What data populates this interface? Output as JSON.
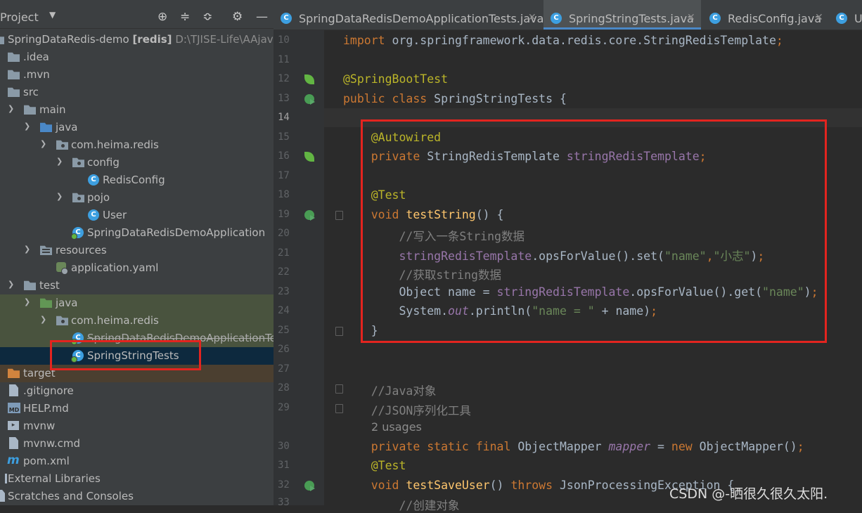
{
  "sidebar": {
    "title": "Project",
    "tree": [
      {
        "label": "SpringDataRedis-demo",
        "bold": "[redis]",
        "path": "D:\\TJISE-Life\\AAjava-",
        "icon": "module-icon"
      },
      {
        "label": ".idea",
        "icon": "folder-icon"
      },
      {
        "label": ".mvn",
        "icon": "folder-icon"
      },
      {
        "label": "src",
        "icon": "folder-icon"
      },
      {
        "label": "main",
        "icon": "folder-icon"
      },
      {
        "label": "java",
        "icon": "source-folder-icon"
      },
      {
        "label": "com.heima.redis",
        "icon": "package-icon"
      },
      {
        "label": "config",
        "icon": "package-icon"
      },
      {
        "label": "RedisConfig",
        "icon": "class-icon"
      },
      {
        "label": "pojo",
        "icon": "package-icon"
      },
      {
        "label": "User",
        "icon": "class-icon"
      },
      {
        "label": "SpringDataRedisDemoApplication",
        "icon": "spring-boot-class-icon"
      },
      {
        "label": "resources",
        "icon": "resources-folder-icon"
      },
      {
        "label": "application.yaml",
        "icon": "yaml-file-icon"
      },
      {
        "label": "test",
        "icon": "folder-icon"
      },
      {
        "label": "java",
        "icon": "test-source-folder-icon"
      },
      {
        "label": "com.heima.redis",
        "icon": "package-icon"
      },
      {
        "label": "SpringDataRedisDemoApplicationTests",
        "icon": "test-class-icon"
      },
      {
        "label": "SpringStringTests",
        "icon": "test-class-icon"
      },
      {
        "label": "target",
        "icon": "excluded-folder-icon"
      },
      {
        "label": ".gitignore",
        "icon": "file-icon"
      },
      {
        "label": "HELP.md",
        "icon": "markdown-icon"
      },
      {
        "label": "mvnw",
        "icon": "terminal-icon"
      },
      {
        "label": "mvnw.cmd",
        "icon": "file-icon"
      },
      {
        "label": "pom.xml",
        "icon": "maven-icon"
      },
      {
        "label": "External Libraries",
        "icon": "library-icon"
      },
      {
        "label": "Scratches and Consoles",
        "icon": "scratches-icon"
      }
    ]
  },
  "tabs": [
    {
      "label": "SpringDataRedisDemoApplicationTests.java",
      "icon": "class-icon",
      "active": false
    },
    {
      "label": "SpringStringTests.java",
      "icon": "class-icon",
      "active": true
    },
    {
      "label": "RedisConfig.java",
      "icon": "class-icon",
      "active": false
    },
    {
      "label": "U",
      "icon": "class-icon",
      "active": false
    }
  ],
  "editor": {
    "line_numbers": [
      "10",
      "11",
      "12",
      "13",
      "14",
      "15",
      "16",
      "17",
      "18",
      "19",
      "20",
      "21",
      "22",
      "23",
      "24",
      "25",
      "26",
      "27",
      "28",
      "29",
      "30",
      "31",
      "32",
      "33"
    ],
    "current_line": "14",
    "usages_hint": "2 usages",
    "code": [
      {
        "seg": [
          {
            "c": "kw",
            "t": "import "
          },
          {
            "c": "",
            "t": "org.springframework.data.redis.core.StringRedisTemplate"
          },
          {
            "c": "kw",
            "t": ";"
          }
        ]
      },
      {
        "seg": []
      },
      {
        "seg": [
          {
            "c": "an",
            "t": "@SpringBootTest"
          }
        ]
      },
      {
        "seg": [
          {
            "c": "kw",
            "t": "public class "
          },
          {
            "c": "",
            "t": "SpringStringTests {"
          }
        ]
      },
      {
        "seg": []
      },
      {
        "seg": [
          {
            "c": "an",
            "t": "    @Autowired"
          }
        ]
      },
      {
        "seg": [
          {
            "c": "kw",
            "t": "    private "
          },
          {
            "c": "",
            "t": "StringRedisTemplate "
          },
          {
            "c": "fd",
            "t": "stringRedisTemplate"
          },
          {
            "c": "kw",
            "t": ";"
          }
        ]
      },
      {
        "seg": []
      },
      {
        "seg": [
          {
            "c": "an",
            "t": "    @Test"
          }
        ]
      },
      {
        "seg": [
          {
            "c": "kw",
            "t": "    void "
          },
          {
            "c": "fn",
            "t": "testString"
          },
          {
            "c": "",
            "t": "() {"
          }
        ]
      },
      {
        "seg": [
          {
            "c": "cm",
            "t": "        //写入一条String数据"
          }
        ]
      },
      {
        "seg": [
          {
            "c": "fd",
            "t": "        stringRedisTemplate"
          },
          {
            "c": "",
            "t": ".opsForValue().set("
          },
          {
            "c": "st",
            "t": "\"name\""
          },
          {
            "c": "kw",
            "t": ","
          },
          {
            "c": "st",
            "t": "\"小志\""
          },
          {
            "c": "",
            "t": ")"
          },
          {
            "c": "kw",
            "t": ";"
          }
        ]
      },
      {
        "seg": [
          {
            "c": "cm",
            "t": "        //获取string数据"
          }
        ]
      },
      {
        "seg": [
          {
            "c": "",
            "t": "        Object name = "
          },
          {
            "c": "fd",
            "t": "stringRedisTemplate"
          },
          {
            "c": "",
            "t": ".opsForValue().get("
          },
          {
            "c": "st",
            "t": "\"name\""
          },
          {
            "c": "",
            "t": ")"
          },
          {
            "c": "kw",
            "t": ";"
          }
        ]
      },
      {
        "seg": [
          {
            "c": "",
            "t": "        System."
          },
          {
            "c": "it",
            "t": "out"
          },
          {
            "c": "",
            "t": ".println("
          },
          {
            "c": "st",
            "t": "\"name = \""
          },
          {
            "c": "",
            "t": " + name)"
          },
          {
            "c": "kw",
            "t": ";"
          }
        ]
      },
      {
        "seg": [
          {
            "c": "",
            "t": "    }"
          }
        ]
      },
      {
        "seg": []
      },
      {
        "seg": []
      },
      {
        "seg": [
          {
            "c": "cm",
            "t": "    //Java对象"
          }
        ]
      },
      {
        "seg": [
          {
            "c": "cm",
            "t": "    //JSON序列化工具"
          }
        ]
      },
      {
        "seg": [
          {
            "c": "kw",
            "t": "    private static final "
          },
          {
            "c": "",
            "t": "ObjectMapper "
          },
          {
            "c": "it",
            "t": "mapper"
          },
          {
            "c": "",
            "t": " = "
          },
          {
            "c": "kw",
            "t": "new "
          },
          {
            "c": "",
            "t": "ObjectMapper()"
          },
          {
            "c": "kw",
            "t": ";"
          }
        ]
      },
      {
        "seg": [
          {
            "c": "an",
            "t": "    @Test"
          }
        ]
      },
      {
        "seg": [
          {
            "c": "kw",
            "t": "    void "
          },
          {
            "c": "fn",
            "t": "testSaveUser"
          },
          {
            "c": "",
            "t": "() "
          },
          {
            "c": "kw",
            "t": "throws "
          },
          {
            "c": "",
            "t": "JsonProcessingException {"
          }
        ]
      },
      {
        "seg": [
          {
            "c": "cm",
            "t": "        //创建对象"
          }
        ]
      }
    ]
  },
  "watermark": "CSDN @-晒很久很久太阳."
}
